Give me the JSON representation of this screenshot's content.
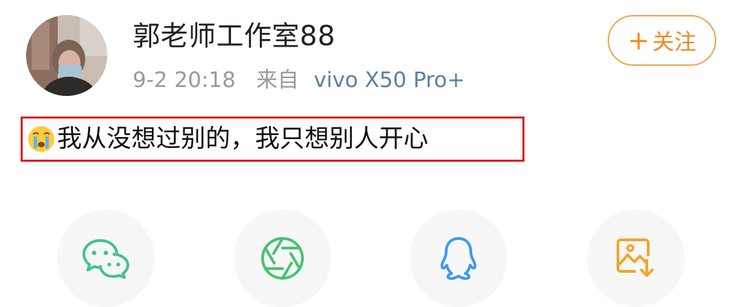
{
  "post": {
    "author_name": "郭老师工作室88",
    "time": "9-2 20:18",
    "from_label": "来自",
    "device": "vivo X50 Pro+",
    "follow_label": "关注",
    "follow_plus": "+",
    "text": "我从没想过别的，我只想别人开心",
    "emoji": "crying-face-icon"
  },
  "share": {
    "items": [
      {
        "icon": "wechat-icon",
        "color": "#3fc48f"
      },
      {
        "icon": "moments-icon",
        "color": "#48c271"
      },
      {
        "icon": "qq-icon",
        "color": "#3b9bf0"
      },
      {
        "icon": "save-image-icon",
        "color": "#f2a52a"
      }
    ]
  },
  "colors": {
    "follow_accent": "#f08a22",
    "device_link": "#5b7fa6",
    "highlight_border": "#e01b1b"
  }
}
